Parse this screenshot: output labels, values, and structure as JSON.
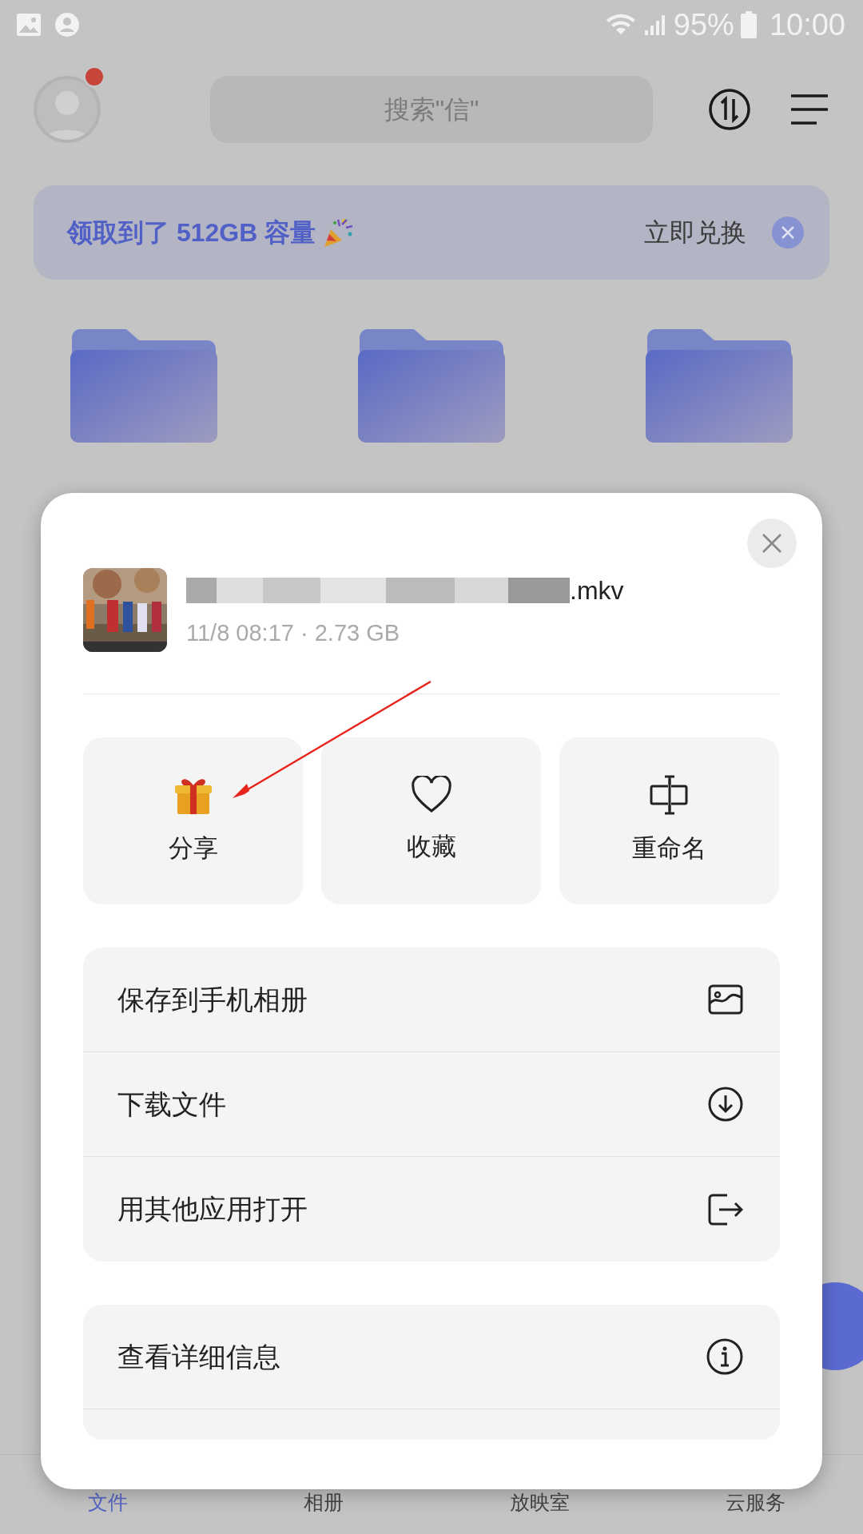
{
  "status_bar": {
    "battery": "95%",
    "time": "10:00"
  },
  "header": {
    "avatar_notification": true,
    "search": {
      "placeholder": "搜索\"信\""
    }
  },
  "banner": {
    "text": "领取到了 512GB 容量",
    "action": "立即兑换"
  },
  "folders": [
    {
      "kind": "folder"
    },
    {
      "kind": "folder"
    },
    {
      "kind": "folder"
    }
  ],
  "sheet": {
    "file": {
      "name": ".mkv",
      "meta": "11/8 08:17 · 2.73 GB"
    },
    "actions": [
      {
        "label": "分享",
        "kind": "gift"
      },
      {
        "label": "收藏",
        "kind": "heart"
      },
      {
        "label": "重命名",
        "kind": "rename"
      }
    ],
    "menu_groups": [
      [
        {
          "label": "保存到手机相册",
          "kind": "save-photo"
        },
        {
          "label": "下载文件",
          "kind": "download"
        },
        {
          "label": "用其他应用打开",
          "kind": "open-with"
        }
      ],
      [
        {
          "label": "查看详细信息",
          "kind": "info"
        }
      ]
    ]
  },
  "bottom_nav": [
    {
      "label": "文件",
      "selected": true
    },
    {
      "label": "相册",
      "selected": false
    },
    {
      "label": "放映室",
      "selected": false
    },
    {
      "label": "云服务",
      "selected": false
    }
  ]
}
